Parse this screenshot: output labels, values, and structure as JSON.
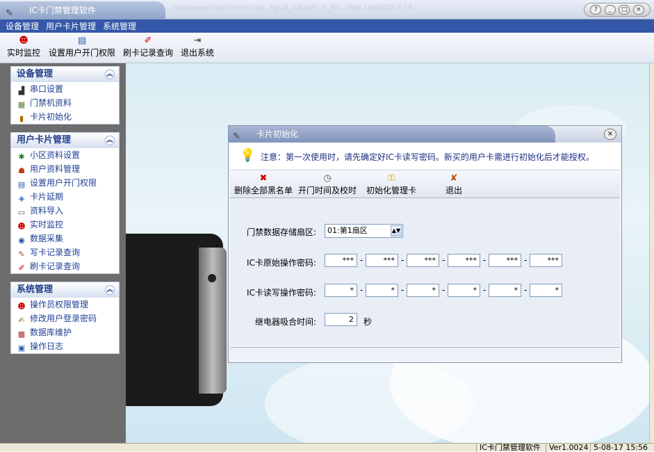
{
  "window": {
    "title": "IC卡门禁管理软件",
    "background_text": "...tp://www.chinaic.com.cn/ic_kg_dl_ic/kazhi_ic_60... 686 1988825 2 24"
  },
  "menu": [
    "设备管理",
    "用户卡片管理",
    "系统管理"
  ],
  "toolbar": [
    {
      "label": "实时监控",
      "icon": "monitor-face-icon"
    },
    {
      "label": "设置用户开门权限",
      "icon": "card-permission-icon"
    },
    {
      "label": "刷卡记录查询",
      "icon": "swipe-record-icon"
    },
    {
      "label": "退出系统",
      "icon": "exit-door-icon"
    }
  ],
  "sidebar": {
    "panels": [
      {
        "title": "设备管理",
        "items": [
          "串口设置",
          "门禁机资料",
          "卡片初始化"
        ]
      },
      {
        "title": "用户卡片管理",
        "items": [
          "小区资料设置",
          "用户资料管理",
          "设置用户开门权限",
          "卡片延期",
          "资料导入",
          "实时监控",
          "数据采集",
          "写卡记录查询",
          "刷卡记录查询"
        ]
      },
      {
        "title": "系统管理",
        "items": [
          "操作员权限管理",
          "修改用户登录密码",
          "数据库维护",
          "操作日志"
        ]
      }
    ]
  },
  "dialog": {
    "title": "卡片初始化",
    "notice": "注意：第一次使用时，请先确定好IC卡读写密码。新买的用户卡需进行初始化后才能授权。",
    "toolbar": [
      {
        "label": "删除全部黑名单",
        "icon": "delete-blacklist-icon"
      },
      {
        "label": "开门时间及校时",
        "icon": "clock-icon"
      },
      {
        "label": "初始化管理卡",
        "icon": "key-icon"
      },
      {
        "label": "退出",
        "icon": "exit-icon"
      }
    ],
    "form": {
      "sector_label": "门禁数据存储扇区:",
      "sector_value": "01:第1扇区",
      "orig_pw_label": "IC卡原始操作密码:",
      "orig_pw": [
        "***",
        "***",
        "***",
        "***",
        "***",
        "***"
      ],
      "rw_pw_label": "IC卡读写操作密码:",
      "rw_pw": [
        "*",
        "*",
        "*",
        "*",
        "*",
        "*"
      ],
      "relay_label": "继电器吸合时间:",
      "relay_value": "2",
      "relay_unit": "秒"
    }
  },
  "statusbar": {
    "app": "IC卡门禁管理软件",
    "version": "Ver1.00240",
    "datetime": "5-08-17 15:56"
  }
}
